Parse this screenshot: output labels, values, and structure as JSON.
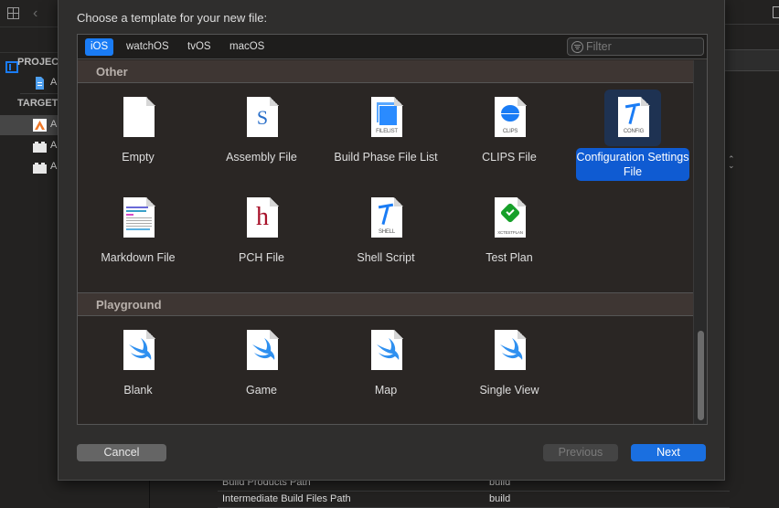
{
  "background": {
    "sidebar": {
      "sections": [
        {
          "label": "PROJEC",
          "items": [
            {
              "label": "A",
              "icon": "project-file-icon"
            }
          ]
        },
        {
          "label": "TARGET",
          "items": [
            {
              "label": "A",
              "icon": "app-target-icon",
              "selected": true
            },
            {
              "label": "A",
              "icon": "bundle-target-icon"
            },
            {
              "label": "A",
              "icon": "bundle-target-icon"
            }
          ]
        }
      ]
    },
    "settings_rows": [
      {
        "key": "Build Products Path",
        "value": "build"
      },
      {
        "key": "Intermediate Build Files Path",
        "value": "build"
      }
    ]
  },
  "dialog": {
    "title": "Choose a template for your new file:",
    "platform_tabs": [
      {
        "label": "iOS",
        "active": true
      },
      {
        "label": "watchOS",
        "active": false
      },
      {
        "label": "tvOS",
        "active": false
      },
      {
        "label": "macOS",
        "active": false
      }
    ],
    "filter": {
      "placeholder": "Filter",
      "value": ""
    },
    "sections": [
      {
        "title": "Other",
        "items": [
          {
            "label": "Empty",
            "icon": "empty-file-icon"
          },
          {
            "label": "Assembly File",
            "icon": "assembly-file-icon",
            "badge": "S"
          },
          {
            "label": "Build Phase File List",
            "icon": "filelist-file-icon",
            "badge": "FILELIST"
          },
          {
            "label": "CLIPS File",
            "icon": "clips-file-icon",
            "badge": "CLIPS"
          },
          {
            "label": "Configuration Settings File",
            "icon": "config-file-icon",
            "badge": "CONFIG",
            "selected": true
          },
          {
            "label": "Markdown File",
            "icon": "markdown-file-icon"
          },
          {
            "label": "PCH File",
            "icon": "pch-file-icon",
            "badge": "h"
          },
          {
            "label": "Shell Script",
            "icon": "shell-script-icon",
            "badge": "SHELL"
          },
          {
            "label": "Test Plan",
            "icon": "test-plan-icon",
            "badge": "XCTESTPLAN"
          }
        ]
      },
      {
        "title": "Playground",
        "items": [
          {
            "label": "Blank",
            "icon": "swift-playground-icon"
          },
          {
            "label": "Game",
            "icon": "swift-playground-icon"
          },
          {
            "label": "Map",
            "icon": "swift-playground-icon"
          },
          {
            "label": "Single View",
            "icon": "swift-playground-icon"
          }
        ]
      }
    ],
    "buttons": {
      "cancel": "Cancel",
      "previous": "Previous",
      "next": "Next"
    }
  },
  "colors": {
    "accent": "#1a7cf5",
    "selection": "#0f5bd2",
    "next_button": "#1a6fe0"
  }
}
